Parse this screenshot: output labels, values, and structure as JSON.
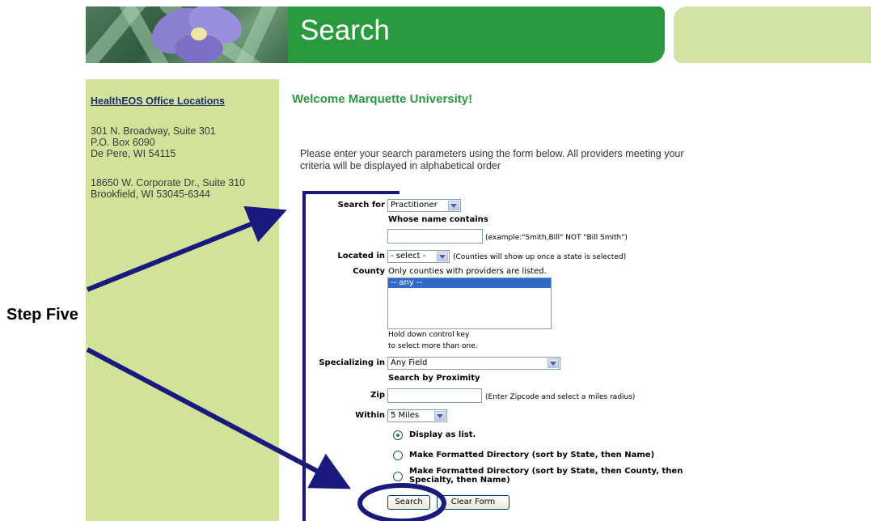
{
  "header": {
    "title": "Search"
  },
  "sidebar": {
    "link": "HealthEOS Office Locations",
    "office1": [
      "301 N. Broadway, Suite 301",
      "P.O. Box 6090",
      "De Pere, WI 54115"
    ],
    "office2": [
      "18650 W. Corporate Dr., Suite 310",
      "Brookfield, WI 53045-6344"
    ]
  },
  "main": {
    "welcome": "Welcome Marquette University!",
    "intro_line1": "Please enter your search parameters using the form below. All providers meeting your",
    "intro_line2": "criteria will be displayed in alphabetical order"
  },
  "form": {
    "search_for_label": "Search for",
    "search_for_value": "Practitioner",
    "name_label": "Whose name contains",
    "name_value": "",
    "name_hint": "(example:\"Smith,Bill\" NOT \"Bill Smith\")",
    "located_label": "Located in",
    "located_value": "- select -",
    "located_hint": "(Counties will show up once a state is selected)",
    "county_label": "County",
    "county_note": "Only counties with providers are listed.",
    "county_options": [
      "-- any --"
    ],
    "county_hint1": "Hold down control key",
    "county_hint2": "to select more than one.",
    "specializing_label": "Specializing in",
    "specializing_value": "Any Field",
    "proximity_label": "Search by Proximity",
    "zip_label": "Zip",
    "zip_value": "",
    "zip_hint": "(Enter Zipcode and select a miles radius)",
    "within_label": "Within",
    "within_value": "5 Miles",
    "options": [
      {
        "label": "Display as list.",
        "selected": true
      },
      {
        "label": "Make Formatted Directory (sort by State, then Name)",
        "selected": false
      },
      {
        "label1": "Make Formatted Directory (sort by State, then County, then",
        "label2": "Specialty, then Name)",
        "selected": false
      }
    ],
    "search_button": "Search",
    "clear_button": "Clear Form"
  },
  "annotation": {
    "step_label": "Step Five",
    "color": "#1a1a7e"
  },
  "colors": {
    "brand_green": "#2a9a3f",
    "sidebar_bg": "#d2e29a",
    "link": "#1f2f6a"
  }
}
